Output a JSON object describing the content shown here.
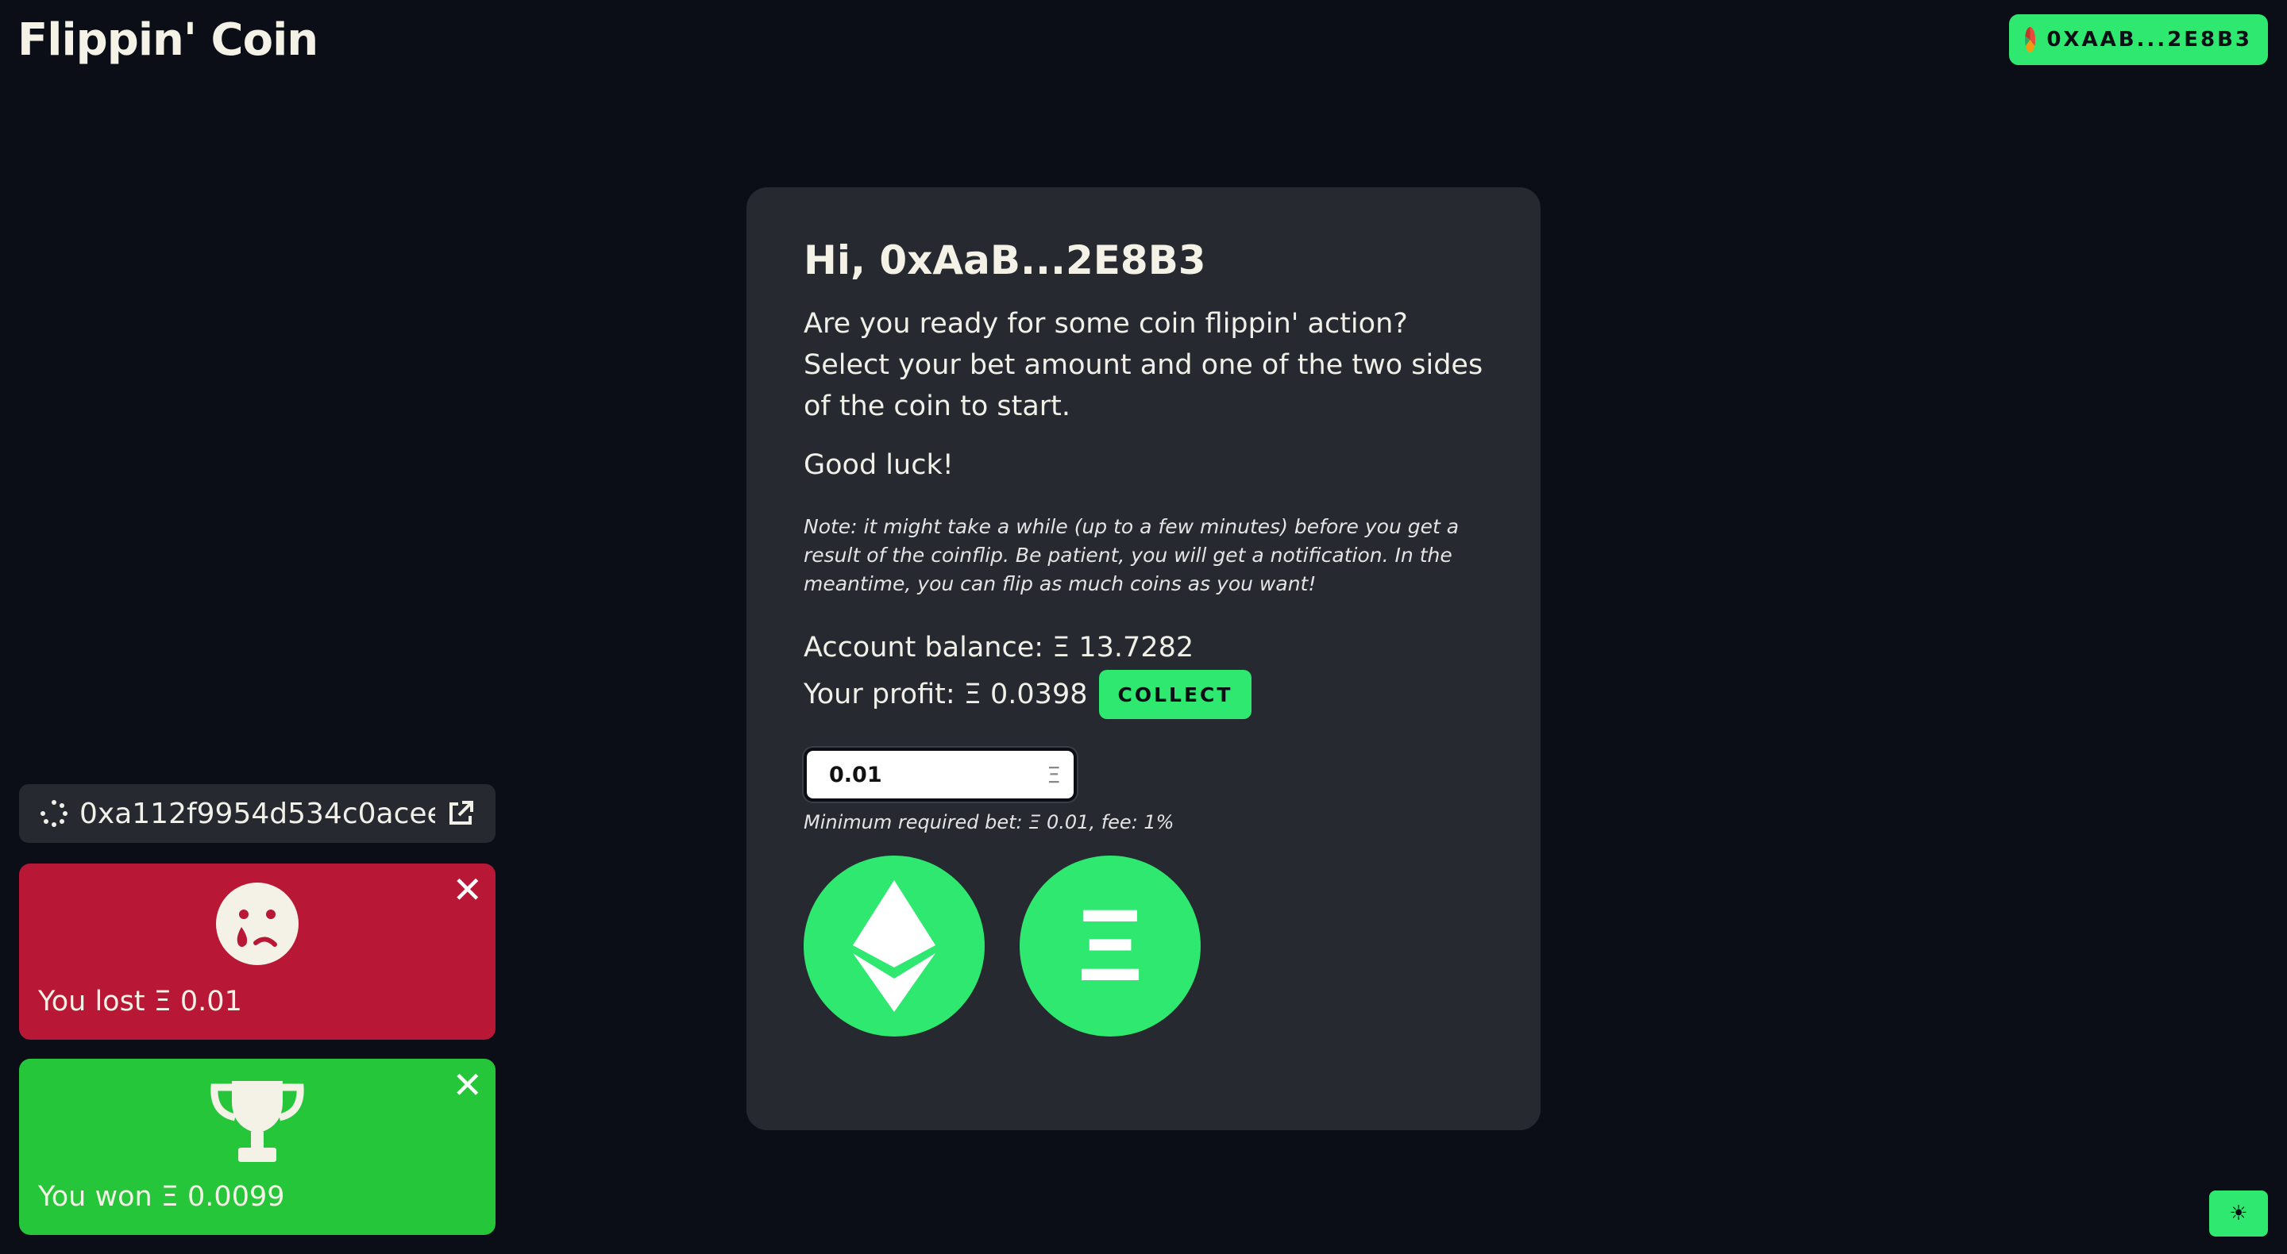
{
  "header": {
    "logo": "Flippin' Coin",
    "wallet_label": "0XAAB...2E8B3"
  },
  "card": {
    "greeting": "Hi, 0xAaB...2E8B3",
    "intro": "Are you ready for some coin flippin' action? Select your bet amount and one of the two sides of the coin to start.",
    "good_luck": "Good luck!",
    "note": "Note: it might take a while (up to a few minutes) before you get a result of the coinflip. Be patient, you will get a notification. In the meantime, you can flip as much coins as you want!",
    "balance": "Account balance: Ξ 13.7282",
    "profit": "Your profit: Ξ 0.0398",
    "collect_label": "COLLECT",
    "bet_value": "0.01",
    "bet_currency_symbol": "Ξ",
    "min_bet_text": "Minimum required bet: Ξ 0.01, fee: 1%",
    "coin_sides": [
      {
        "icon": "ethereum-logo-icon"
      },
      {
        "icon": "xi-symbol-icon",
        "glyph": "Ξ"
      }
    ]
  },
  "notifications": {
    "pending_tx": "0xa112f9954d534c0acee...",
    "lost": {
      "text": "You lost Ξ 0.01",
      "icon": "sad-face-icon",
      "color": "#b81835"
    },
    "won": {
      "text": "You won Ξ 0.0099",
      "icon": "trophy-icon",
      "color": "#26c63a"
    }
  },
  "colors": {
    "background": "#0b0d17",
    "card": "#262930",
    "accent": "#2ee86f"
  }
}
